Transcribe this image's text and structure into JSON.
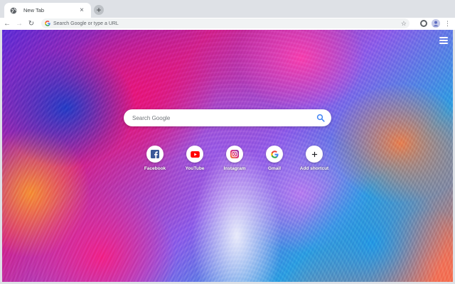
{
  "tab": {
    "title": "New Tab",
    "close_glyph": "×"
  },
  "tabstrip": {
    "new_tab_glyph": "+"
  },
  "toolbar": {
    "back_glyph": "←",
    "forward_glyph": "→",
    "reload_glyph": "↻",
    "omnibox_placeholder": "Search Google or type a URL",
    "star_glyph": "☆",
    "menu_glyph": "⋮"
  },
  "ntp": {
    "search_placeholder": "Search Google",
    "shortcuts": [
      {
        "label": "Facebook",
        "icon": "facebook-icon",
        "color": "#3b5998"
      },
      {
        "label": "YouTube",
        "icon": "youtube-icon",
        "color": "#ff0000"
      },
      {
        "label": "Instagram",
        "icon": "instagram-icon",
        "color": "#c13584"
      },
      {
        "label": "Gmail",
        "icon": "google-icon",
        "color": "#4285f4"
      },
      {
        "label": "Add shortcut",
        "icon": "plus-icon",
        "color": "#202124"
      }
    ]
  },
  "colors": {
    "tabstrip_bg": "#dee1e6",
    "toolbar_bg": "#ffffff",
    "omnibox_bg": "#f1f3f4",
    "google_blue": "#4285f4"
  }
}
